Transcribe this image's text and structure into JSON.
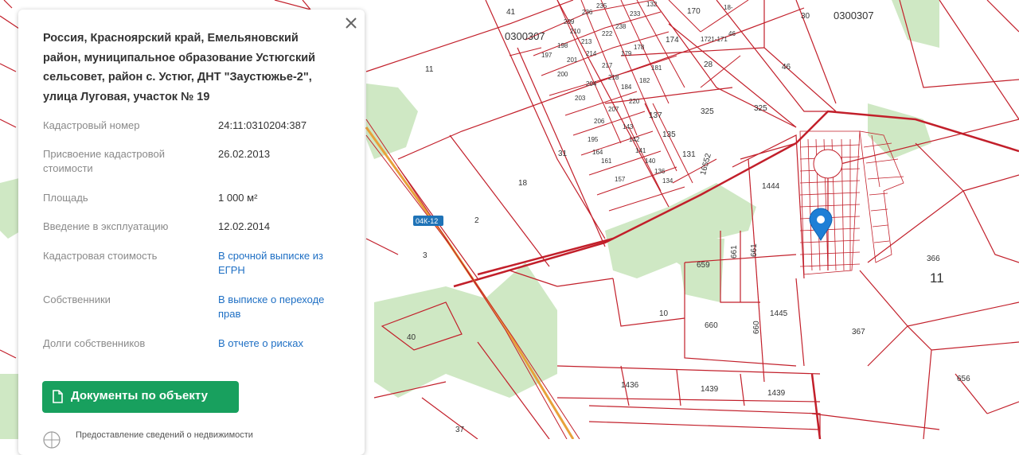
{
  "map": {
    "labels": [
      "41",
      "0300307",
      "30",
      "0300307",
      "170",
      "174",
      "28",
      "46",
      "11",
      "325",
      "325",
      "31",
      "18",
      "2",
      "3",
      "137",
      "135",
      "131",
      "16552",
      "1444",
      "366",
      "11",
      "659",
      "661",
      "661",
      "10",
      "660",
      "660",
      "1445",
      "367",
      "40",
      "656",
      "1436",
      "1439",
      "1439",
      "37",
      "04К-12"
    ],
    "small_labels": [
      "235",
      "236",
      "233",
      "132",
      "209",
      "210",
      "213",
      "222",
      "238",
      "197",
      "198",
      "201",
      "214",
      "179",
      "178",
      "200",
      "217",
      "218",
      "181",
      "204",
      "184",
      "182",
      "203",
      "207",
      "220",
      "206",
      "143",
      "195",
      "142",
      "164",
      "141",
      "161",
      "140",
      "157",
      "136",
      "134",
      "18-",
      "1721-171",
      "46"
    ]
  },
  "info": {
    "address": "Россия, Красноярский край, Емельяновский район, муниципальное образование Устюгский сельсовет, район с. Устюг, ДНТ \"Заустюжье-2\", улица Луговая, участок № 19",
    "rows": [
      {
        "label": "Кадастровый номер",
        "value": "24:11:0310204:387"
      },
      {
        "label": "Присвоение кадастровой стоимости",
        "value": "26.02.2013"
      },
      {
        "label": "Площадь",
        "value": "1 000 м²"
      },
      {
        "label": "Введение в эксплуатацию",
        "value": "12.02.2014"
      },
      {
        "label": "Кадастровая стоимость",
        "value": "В срочной выписке из ЕГРН"
      },
      {
        "label": "Собственники",
        "value": "В выписке о переходе прав"
      },
      {
        "label": "Долги собственников",
        "value": "В отчете о рисках"
      }
    ],
    "button_label": "Документы по объекту",
    "footer_text": "Предоставление сведений о недвижимости"
  },
  "colors": {
    "parcel_line": "#c21f2a",
    "forest": "#cfe8c4",
    "accent": "#18a05e",
    "link": "#1e6fc4",
    "marker": "#1e7fd6"
  }
}
